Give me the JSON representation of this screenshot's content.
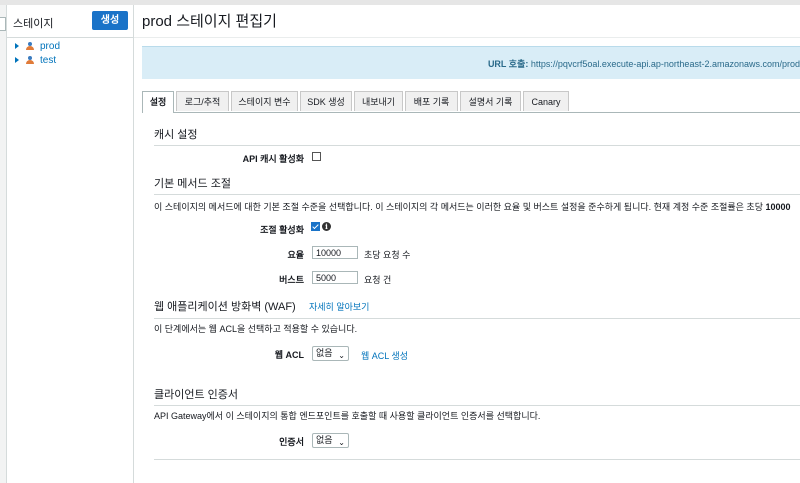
{
  "sidebar": {
    "title": "스테이지",
    "create_button": "생성",
    "stages": [
      {
        "label": "prod"
      },
      {
        "label": "test"
      }
    ]
  },
  "page": {
    "title": "prod 스테이지 편집기",
    "url_label": "URL 호출:",
    "url_value": " https://pqvcrf5oal.execute-api.ap-northeast-2.amazonaws.com/prod"
  },
  "tabs": [
    {
      "label": "설정",
      "active": true
    },
    {
      "label": "로그/추적"
    },
    {
      "label": "스테이지 변수"
    },
    {
      "label": "SDK 생성"
    },
    {
      "label": "내보내기"
    },
    {
      "label": "배포 기록"
    },
    {
      "label": "설명서 기록"
    },
    {
      "label": "Canary"
    }
  ],
  "cache": {
    "heading": "캐시 설정",
    "enable_label": "API 캐시 활성화",
    "enabled": false
  },
  "throttling": {
    "heading": "기본 메서드 조절",
    "description": "이 스테이지의 메서드에 대한 기본 조절 수준을 선택합니다. 이 스테이지의 각 메서드는 이러한 요율 및 버스트 설정을 준수하게 됩니다. 현재 계정 수준 조절률은 초당 ",
    "description_bold": "10000",
    "enable_label": "조절 활성화",
    "enabled": true,
    "rate_label": "요율",
    "rate_value": "10000",
    "rate_unit": "초당 요청 수",
    "burst_label": "버스트",
    "burst_value": "5000",
    "burst_unit": "요청 건"
  },
  "waf": {
    "heading": "웹 애플리케이션 방화벽 (WAF)",
    "learn_more": "자세히 알아보기",
    "description": "이 단계에서는 웹 ACL을 선택하고 적용할 수 있습니다.",
    "acl_label": "웹 ACL",
    "acl_value": "없음",
    "create_link": "웹 ACL 생성"
  },
  "client_cert": {
    "heading": "클라이언트 인증서",
    "description": "API Gateway에서 이 스테이지의 통합 엔드포인트를 호출할 때 사용할 클라이언트 인증서를 선택합니다.",
    "cert_label": "인증서",
    "cert_value": "없음"
  }
}
